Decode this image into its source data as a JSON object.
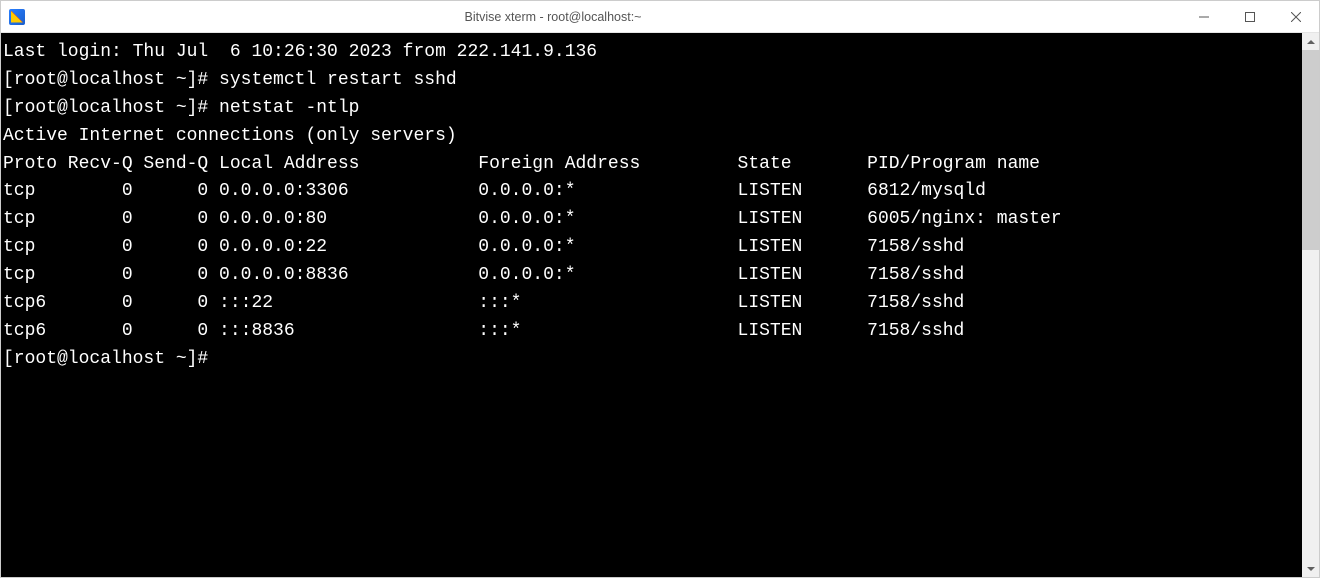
{
  "window": {
    "title": "Bitvise xterm - root@localhost:~"
  },
  "terminal": {
    "lines": {
      "l0": "Last login: Thu Jul  6 10:26:30 2023 from 222.141.9.136",
      "l1": "[root@localhost ~]# systemctl restart sshd",
      "l2": "[root@localhost ~]# netstat -ntlp",
      "l3": "Active Internet connections (only servers)",
      "l4": "Proto Recv-Q Send-Q Local Address           Foreign Address         State       PID/Program name",
      "l5": "tcp        0      0 0.0.0.0:3306            0.0.0.0:*               LISTEN      6812/mysqld",
      "l6": "tcp        0      0 0.0.0.0:80              0.0.0.0:*               LISTEN      6005/nginx: master",
      "l7": "tcp        0      0 0.0.0.0:22              0.0.0.0:*               LISTEN      7158/sshd",
      "l8": "tcp        0      0 0.0.0.0:8836            0.0.0.0:*               LISTEN      7158/sshd",
      "l9": "tcp6       0      0 :::22                   :::*                    LISTEN      7158/sshd",
      "l10": "tcp6       0      0 :::8836                 :::*                    LISTEN      7158/sshd",
      "l11": "[root@localhost ~]# "
    }
  }
}
